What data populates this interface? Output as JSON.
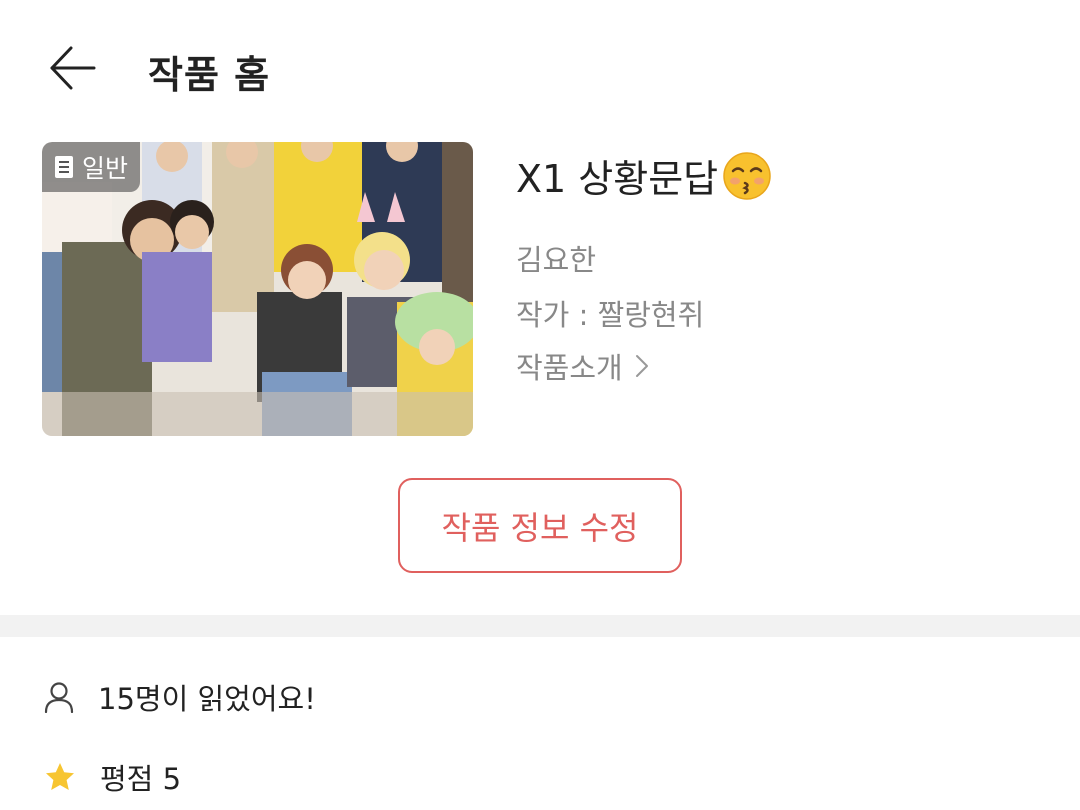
{
  "header": {
    "title": "작품 홈",
    "back_icon": "arrow-left-icon"
  },
  "cover": {
    "badge_label": "일반",
    "badge_icon": "document-icon"
  },
  "work": {
    "title": "X1 상황문답",
    "title_emoji": "kissing-face-with-closed-eyes-icon",
    "owner": "김요한",
    "author": "작가 : 짤랑현쥐",
    "intro_label": "작품소개"
  },
  "actions": {
    "edit_label": "작품 정보 수정"
  },
  "stats": {
    "reads": "15명이 읽었어요!",
    "rating": "평점 5"
  },
  "colors": {
    "accent": "#e0605e",
    "muted_text": "#888888",
    "divider": "#f2f2f2",
    "star": "#f7c531"
  }
}
